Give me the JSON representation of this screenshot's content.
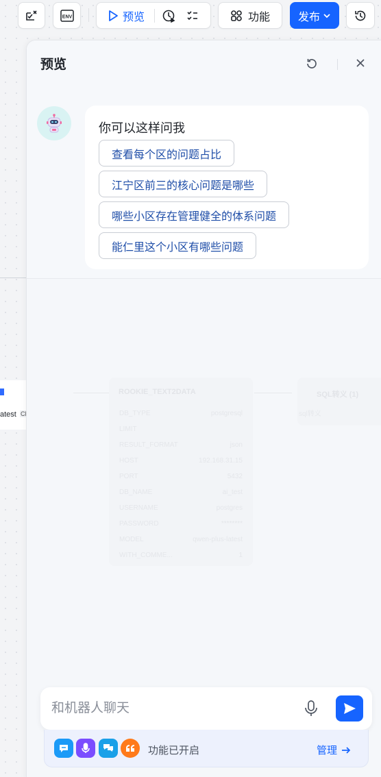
{
  "toolbar": {
    "preview_label": "预览",
    "features_label": "功能",
    "publish_label": "发布",
    "env_icon_text": "ENV"
  },
  "canvas": {
    "left_node_text": "atest",
    "left_node_tag": "CH",
    "node_title": "ROOKIE_TEXT2DATA",
    "node_rows": [
      {
        "k": "DB_TYPE",
        "v": "postgresql"
      },
      {
        "k": "LIMIT",
        "v": ""
      },
      {
        "k": "RESULT_FORMAT",
        "v": "json"
      },
      {
        "k": "HOST",
        "v": "192.168.31.15"
      },
      {
        "k": "PORT",
        "v": "5432"
      },
      {
        "k": "DB_NAME",
        "v": "ai_test"
      },
      {
        "k": "USERNAME",
        "v": "postgres"
      },
      {
        "k": "PASSWORD",
        "v": "********"
      },
      {
        "k": "MODEL",
        "v": "qwen-plus-latest"
      },
      {
        "k": "WITH_COMME...",
        "v": "1"
      }
    ],
    "node2_title": "SQL转义 (1)",
    "node2_sub": "sql转义"
  },
  "panel": {
    "title": "预览",
    "greeting": "你可以这样问我",
    "suggestions": [
      "查看每个区的问题占比",
      "江宁区前三的核心问题是哪些",
      "哪些小区存在管理健全的体系问题",
      "能仁里这个小区有哪些问题"
    ]
  },
  "chat": {
    "placeholder": "和机器人聊天",
    "features_status": "功能已开启",
    "manage_label": "管理"
  },
  "colors": {
    "accent": "#1664ff",
    "feature_blue": "#1b9af7",
    "feature_purple": "#7b4dff",
    "feature_cyan": "#1aa0e8",
    "feature_orange": "#ff7a1a"
  }
}
